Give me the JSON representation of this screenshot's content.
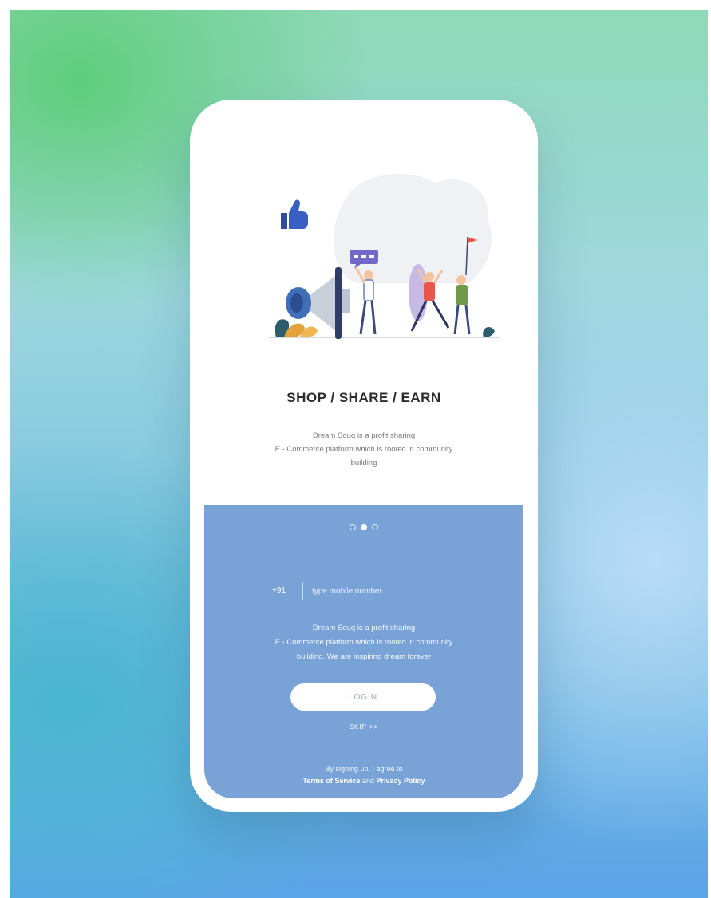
{
  "onboarding": {
    "headline": "SHOP / SHARE / EARN",
    "description_line1": "Dream Souq is a profit sharing",
    "description_line2": "E - Commerce platform which is rooted in community",
    "description_line3": "building"
  },
  "pager": {
    "total": 3,
    "active_index": 1
  },
  "login": {
    "country_code": "+91",
    "mobile_placeholder": "type mobile number",
    "description_line1": "Dream Souq is a profit sharing",
    "description_line2": "E - Commerce platform which is rooted in community",
    "description_line3": "building. We are inspiring dream forever",
    "login_button": "LOGIN",
    "skip_label": "SKIP >>",
    "terms_prefix": "By signing up, I agree to",
    "terms_link": "Terms of Service",
    "terms_and": "and",
    "privacy_link": "Privacy Policy"
  },
  "colors": {
    "panel_blue": "#79a3d6",
    "background_green": "#5fcd7c",
    "background_blue": "#5aa4e8"
  }
}
